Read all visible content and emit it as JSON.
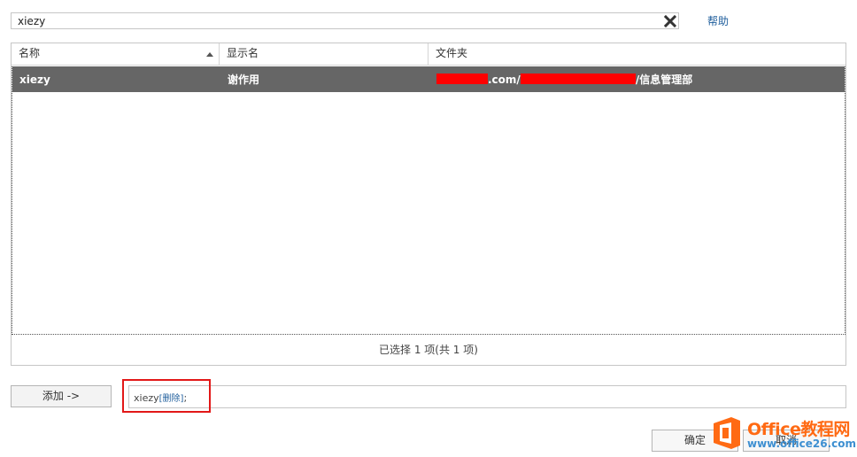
{
  "search": {
    "value": "xiezy",
    "placeholder": ""
  },
  "toolbar": {
    "clear_icon": "close-icon",
    "help_label": "帮助"
  },
  "table": {
    "columns": [
      {
        "label": "名称",
        "sorted": "ascending"
      },
      {
        "label": "显示名"
      },
      {
        "label": "文件夹"
      }
    ],
    "rows": [
      {
        "name": "xiezy",
        "display_name": "谢作用",
        "folder_mid": ".com/",
        "folder_end": "/信息管理部",
        "selected": true
      }
    ],
    "footer_status": "已选择 1 项(共 1 项)"
  },
  "add": {
    "button_label": "添加 ->",
    "recipient_name": "xiezy",
    "delete_label": "[删除]",
    "separator": ";"
  },
  "actions": {
    "ok_label": "确定",
    "cancel_label": "取消"
  },
  "watermark": {
    "title": "Office教程网",
    "url": "www.office26.com"
  },
  "colors": {
    "selected_row": "#666666",
    "link": "#1f5e9c",
    "highlight": "#e21818",
    "redaction": "#ff0000",
    "watermark_orange": "#ff6a13",
    "watermark_blue": "#3d8fd1"
  }
}
